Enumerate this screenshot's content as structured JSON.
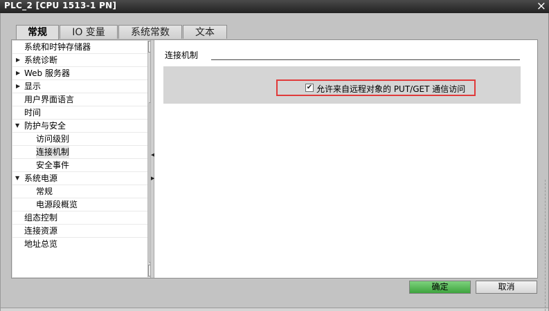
{
  "window": {
    "title": "PLC_2 [CPU 1513-1 PN]",
    "close_glyph": "×"
  },
  "tabs": [
    {
      "label": "常规",
      "active": true
    },
    {
      "label": "IO 变量",
      "active": false
    },
    {
      "label": "系统常数",
      "active": false
    },
    {
      "label": "文本",
      "active": false
    }
  ],
  "tree": {
    "items": [
      {
        "label": "系统和时钟存储器",
        "level": 0,
        "expander": ""
      },
      {
        "label": "系统诊断",
        "level": 0,
        "expander": "▶"
      },
      {
        "label": "Web 服务器",
        "level": 0,
        "expander": "▶"
      },
      {
        "label": "显示",
        "level": 0,
        "expander": "▶"
      },
      {
        "label": "用户界面语言",
        "level": 0,
        "expander": ""
      },
      {
        "label": "时间",
        "level": 0,
        "expander": ""
      },
      {
        "label": "防护与安全",
        "level": 0,
        "expander": "▼"
      },
      {
        "label": "访问级别",
        "level": 1,
        "expander": ""
      },
      {
        "label": "连接机制",
        "level": 1,
        "expander": "",
        "selected": true
      },
      {
        "label": "安全事件",
        "level": 1,
        "expander": ""
      },
      {
        "label": "系统电源",
        "level": 0,
        "expander": "▼"
      },
      {
        "label": "常规",
        "level": 1,
        "expander": ""
      },
      {
        "label": "电源段概览",
        "level": 1,
        "expander": ""
      },
      {
        "label": "组态控制",
        "level": 0,
        "expander": ""
      },
      {
        "label": "连接资源",
        "level": 0,
        "expander": ""
      },
      {
        "label": "地址总览",
        "level": 0,
        "expander": ""
      }
    ]
  },
  "content": {
    "section_title": "连接机制",
    "checkbox_label": "允许来自远程对象的 PUT/GET 通信访问",
    "checkbox_checked": true,
    "check_glyph": "✔"
  },
  "buttons": {
    "ok": "确定",
    "cancel": "取消"
  },
  "colors": {
    "highlight": "#e03a3a",
    "ok_button": "#4caf50"
  }
}
